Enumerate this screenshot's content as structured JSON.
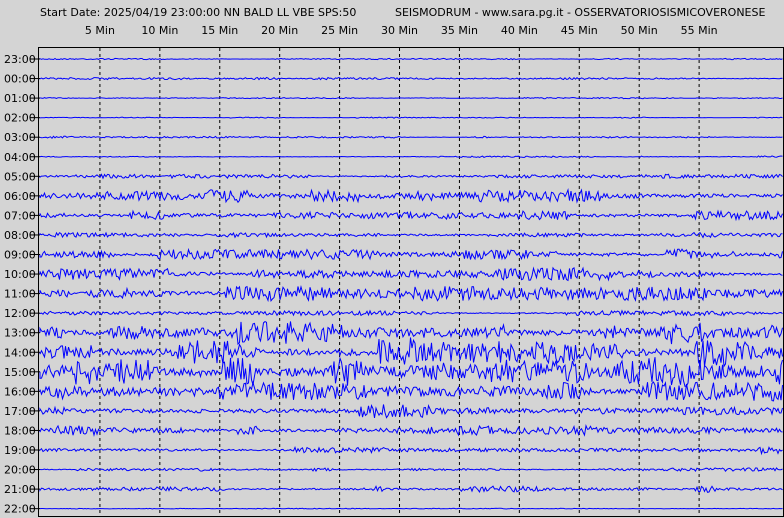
{
  "header": {
    "start_label": "Start Date: 2025/04/19 23:00:00 NN BALD LL VBE SPS:50",
    "station_label": "SEISMODRUM - www.sara.pg.it - OSSERVATORIOSISMICOVERONESE"
  },
  "chart_data": {
    "type": "line",
    "x_unit": "minutes",
    "xlim": [
      0,
      62
    ],
    "x_ticks": [
      {
        "value": 5,
        "label": "5 Min"
      },
      {
        "value": 10,
        "label": "10 Min"
      },
      {
        "value": 15,
        "label": "15 Min"
      },
      {
        "value": 20,
        "label": "20 Min"
      },
      {
        "value": 25,
        "label": "25 Min"
      },
      {
        "value": 30,
        "label": "30 Min"
      },
      {
        "value": 35,
        "label": "35 Min"
      },
      {
        "value": 40,
        "label": "40 Min"
      },
      {
        "value": 45,
        "label": "45 Min"
      },
      {
        "value": 50,
        "label": "50 Min"
      },
      {
        "value": 55,
        "label": "55 Min"
      }
    ],
    "grid": true,
    "colors": {
      "trace": "#0000ff",
      "background": "#d4d4d4",
      "grid": "#000000"
    },
    "rows": [
      {
        "label": "23:00",
        "amplitude": 0.3
      },
      {
        "label": "00:00",
        "amplitude": 0.5
      },
      {
        "label": "01:00",
        "amplitude": 0.3
      },
      {
        "label": "02:00",
        "amplitude": 0.3
      },
      {
        "label": "03:00",
        "amplitude": 0.5
      },
      {
        "label": "04:00",
        "amplitude": 0.4
      },
      {
        "label": "05:00",
        "amplitude": 1.0
      },
      {
        "label": "06:00",
        "amplitude": 3.0
      },
      {
        "label": "07:00",
        "amplitude": 2.2
      },
      {
        "label": "08:00",
        "amplitude": 1.3
      },
      {
        "label": "09:00",
        "amplitude": 3.2
      },
      {
        "label": "10:00",
        "amplitude": 3.0
      },
      {
        "label": "11:00",
        "amplitude": 3.5
      },
      {
        "label": "12:00",
        "amplitude": 1.2
      },
      {
        "label": "13:00",
        "amplitude": 6.0
      },
      {
        "label": "14:00",
        "amplitude": 7.0
      },
      {
        "label": "15:00",
        "amplitude": 7.0
      },
      {
        "label": "16:00",
        "amplitude": 4.5
      },
      {
        "label": "17:00",
        "amplitude": 3.5
      },
      {
        "label": "18:00",
        "amplitude": 2.5
      },
      {
        "label": "19:00",
        "amplitude": 1.8
      },
      {
        "label": "20:00",
        "amplitude": 0.8
      },
      {
        "label": "21:00",
        "amplitude": 1.5
      },
      {
        "label": "22:00",
        "amplitude": 0.2
      }
    ]
  }
}
